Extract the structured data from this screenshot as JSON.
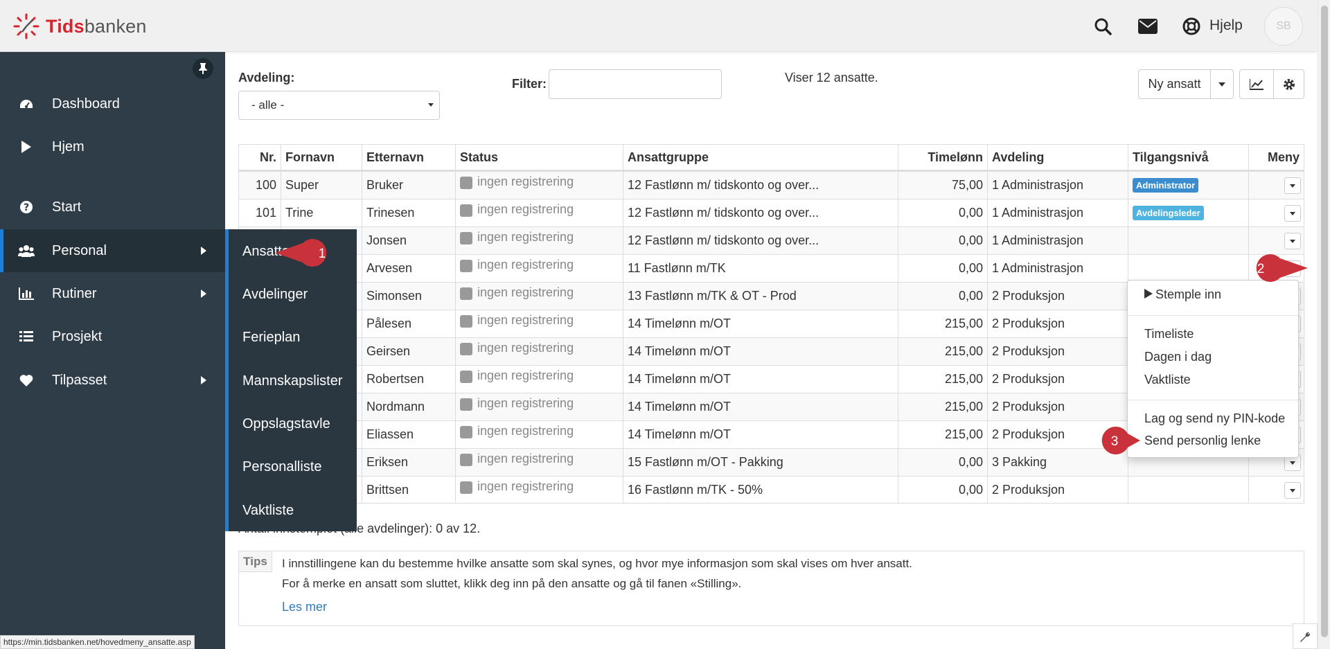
{
  "app": {
    "logo_part1": "Tids",
    "logo_part2": "banken",
    "help_label": "Hjelp",
    "avatar_initials": "SB"
  },
  "sidebar": {
    "items": [
      {
        "label": "Dashboard",
        "icon": "dashboard-icon"
      },
      {
        "label": "Hjem",
        "icon": "play-icon"
      },
      {
        "label": "Start",
        "icon": "question-circle-icon"
      },
      {
        "label": "Personal",
        "icon": "users-icon"
      },
      {
        "label": "Rutiner",
        "icon": "bar-chart-icon"
      },
      {
        "label": "Prosjekt",
        "icon": "list-icon"
      },
      {
        "label": "Tilpasset",
        "icon": "heart-icon"
      }
    ]
  },
  "submenu": {
    "items": [
      "Ansatte",
      "Avdelinger",
      "Ferieplan",
      "Mannskapslister",
      "Oppslagstavle",
      "Personalliste",
      "Vaktliste"
    ]
  },
  "toolbar": {
    "avdeling_label": "Avdeling:",
    "avdeling_value": "- alle -",
    "filter_label": "Filter:",
    "filter_value": "",
    "count_text": "Viser 12 ansatte.",
    "new_employee_label": "Ny ansatt"
  },
  "table": {
    "headers": [
      "Nr.",
      "Fornavn",
      "Etternavn",
      "Status",
      "Ansattgruppe",
      "Timelønn",
      "Avdeling",
      "Tilgangsnivå",
      "Meny"
    ],
    "rows": [
      {
        "nr": "100",
        "fornavn": "Super",
        "etternavn": "Bruker",
        "status": "ingen registrering",
        "gruppe": "12 Fastlønn m/ tidskonto og over...",
        "timelonn": "75,00",
        "avdeling": "1 Administrasjon",
        "tilgang": "Administrator"
      },
      {
        "nr": "101",
        "fornavn": "Trine",
        "etternavn": "Trinesen",
        "status": "ingen registrering",
        "gruppe": "12 Fastlønn m/ tidskonto og over...",
        "timelonn": "0,00",
        "avdeling": "1 Administrasjon",
        "tilgang": "Avdelingsleder"
      },
      {
        "nr": "",
        "fornavn": "",
        "etternavn": "Jonsen",
        "status": "ingen registrering",
        "gruppe": "12 Fastlønn m/ tidskonto og over...",
        "timelonn": "0,00",
        "avdeling": "1 Administrasjon",
        "tilgang": ""
      },
      {
        "nr": "",
        "fornavn": "",
        "etternavn": "Arvesen",
        "status": "ingen registrering",
        "gruppe": "11 Fastlønn m/TK",
        "timelonn": "0,00",
        "avdeling": "1 Administrasjon",
        "tilgang": ""
      },
      {
        "nr": "",
        "fornavn": "",
        "etternavn": "Simonsen",
        "status": "ingen registrering",
        "gruppe": "13 Fastlønn m/TK & OT - Prod",
        "timelonn": "0,00",
        "avdeling": "2 Produksjon",
        "tilgang": ""
      },
      {
        "nr": "",
        "fornavn": "",
        "etternavn": "Pålesen",
        "status": "ingen registrering",
        "gruppe": "14 Timelønn m/OT",
        "timelonn": "215,00",
        "avdeling": "2 Produksjon",
        "tilgang": ""
      },
      {
        "nr": "",
        "fornavn": "",
        "etternavn": "Geirsen",
        "status": "ingen registrering",
        "gruppe": "14 Timelønn m/OT",
        "timelonn": "215,00",
        "avdeling": "2 Produksjon",
        "tilgang": ""
      },
      {
        "nr": "",
        "fornavn": "",
        "etternavn": "Robertsen",
        "status": "ingen registrering",
        "gruppe": "14 Timelønn m/OT",
        "timelonn": "215,00",
        "avdeling": "2 Produksjon",
        "tilgang": ""
      },
      {
        "nr": "",
        "fornavn": "",
        "etternavn": "Nordmann",
        "status": "ingen registrering",
        "gruppe": "14 Timelønn m/OT",
        "timelonn": "215,00",
        "avdeling": "2 Produksjon",
        "tilgang": ""
      },
      {
        "nr": "",
        "fornavn": "",
        "etternavn": "Eliassen",
        "status": "ingen registrering",
        "gruppe": "14 Timelønn m/OT",
        "timelonn": "215,00",
        "avdeling": "2 Produksjon",
        "tilgang": ""
      },
      {
        "nr": "",
        "fornavn": "",
        "etternavn": "Eriksen",
        "status": "ingen registrering",
        "gruppe": "15 Fastlønn m/OT - Pakking",
        "timelonn": "0,00",
        "avdeling": "3 Pakking",
        "tilgang": ""
      },
      {
        "nr": "",
        "fornavn": "",
        "etternavn": "Brittsen",
        "status": "ingen registrering",
        "gruppe": "16 Fastlønn m/TK - 50%",
        "timelonn": "0,00",
        "avdeling": "2 Produksjon",
        "tilgang": ""
      }
    ]
  },
  "dropdown": {
    "stemple_inn": "Stemple inn",
    "timeliste": "Timeliste",
    "dagen_i_dag": "Dagen i dag",
    "vaktliste": "Vaktliste",
    "lag_pin": "Lag og send ny PIN-kode",
    "send_lenke": "Send personlig lenke"
  },
  "callouts": [
    "1",
    "2",
    "3"
  ],
  "summary": "Antall innstemplet (alle avdelinger): 0 av 12.",
  "tips": {
    "label": "Tips",
    "line1": "I innstillingene kan du bestemme hvilke ansatte som skal synes, og hvor mye informasjon som skal vises om hver ansatt.",
    "line2": "For å merke en ansatt som sluttet, klikk deg inn på den ansatte og gå til fanen «Stilling».",
    "link": "Les mer"
  },
  "statusbar_url": "https://min.tidsbanken.net/hovedmeny_ansatte.asp",
  "colors": {
    "sidebar_bg": "#2f3d48",
    "accent_blue": "#1f7fd6",
    "brand_red": "#d6242c",
    "callout_red": "#c9323a",
    "badge_admin": "#3c8dd0",
    "badge_leader": "#4fb3df"
  }
}
